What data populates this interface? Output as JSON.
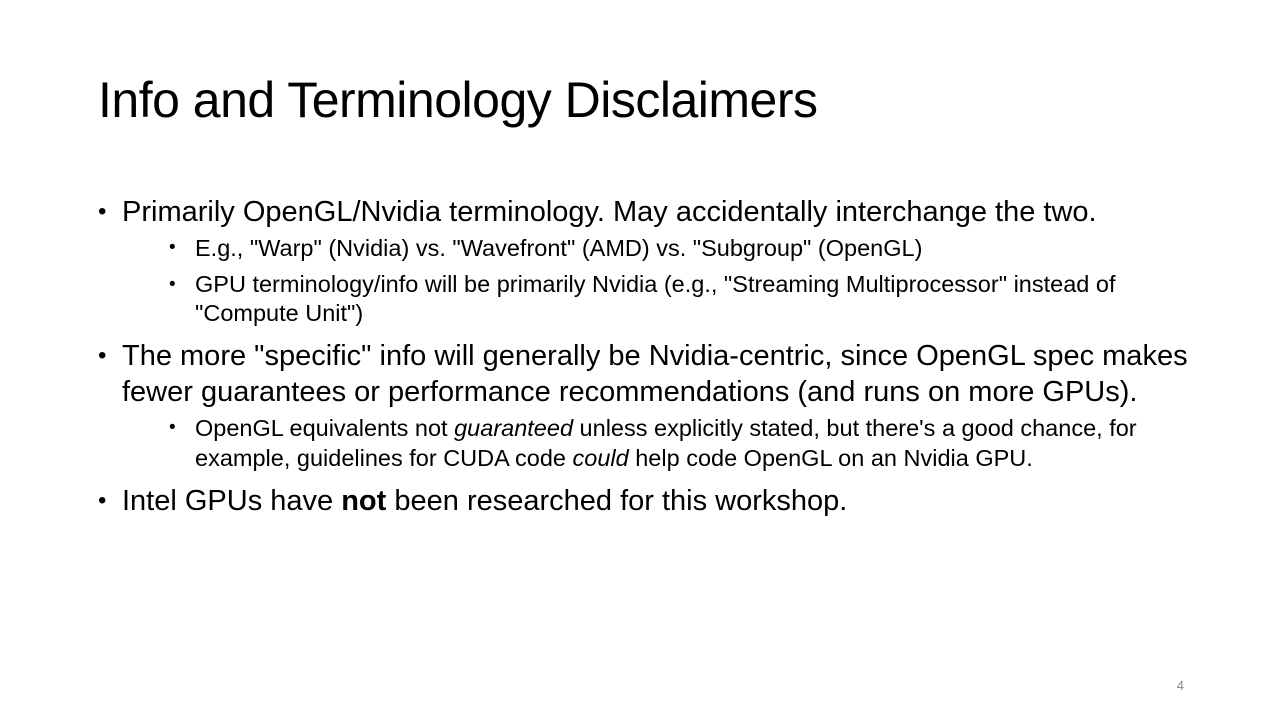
{
  "slide": {
    "title": "Info and Terminology Disclaimers",
    "page_number": "4"
  },
  "bullets": [
    {
      "text": "Primarily OpenGL/Nvidia terminology. May accidentally interchange the two.",
      "sub": [
        "E.g., \"Warp\" (Nvidia) vs. \"Wavefront\" (AMD) vs. \"Subgroup\" (OpenGL)",
        "GPU terminology/info will be primarily Nvidia (e.g., \"Streaming Multiprocessor\" instead of \"Compute Unit\")"
      ]
    },
    {
      "text": "The more \"specific\" info will generally be Nvidia-centric, since OpenGL spec makes fewer guarantees or performance recommendations (and runs on more GPUs).",
      "sub": [
        {
          "part1": "OpenGL equivalents not ",
          "emph1": "guaranteed",
          "part2": " unless explicitly stated, but there's a good chance, for example, guidelines for CUDA code ",
          "emph2": "could",
          "part3": " help code OpenGL on an Nvidia GPU."
        }
      ]
    },
    {
      "part1": "Intel GPUs have ",
      "strong": "not",
      "part2": " been researched for this workshop."
    }
  ]
}
